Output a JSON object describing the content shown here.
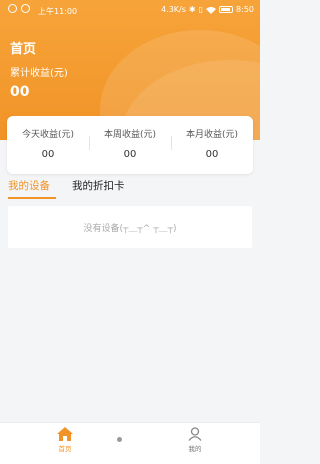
{
  "status_bar": {
    "time": "上午11:00",
    "network_speed": "4.3K/s",
    "clock": "8:50",
    "icons": [
      "notification-icon",
      "notification-icon",
      "bluetooth-icon",
      "vibrate-icon",
      "wifi-icon",
      "battery-icon"
    ]
  },
  "header": {
    "title": "首页",
    "cumulative_label": "累计收益(元)",
    "cumulative_value": "00"
  },
  "stats": [
    {
      "label": "今天收益(元)",
      "value": "00"
    },
    {
      "label": "本周收益(元)",
      "value": "00"
    },
    {
      "label": "本月收益(元)",
      "value": "00"
    }
  ],
  "tabs": [
    {
      "label": "我的设备",
      "active": true
    },
    {
      "label": "我的折扣卡",
      "active": false
    }
  ],
  "empty_state": {
    "text": "没有设备(┬＿┬^ ┬＿┬)"
  },
  "bottom_nav": [
    {
      "label": "首页",
      "icon": "home-icon",
      "active": true
    },
    {
      "label": "我的",
      "icon": "profile-icon",
      "active": false
    }
  ],
  "colors": {
    "accent": "#f19326",
    "header_top": "#f6a43a",
    "background": "#f4f5f7"
  }
}
